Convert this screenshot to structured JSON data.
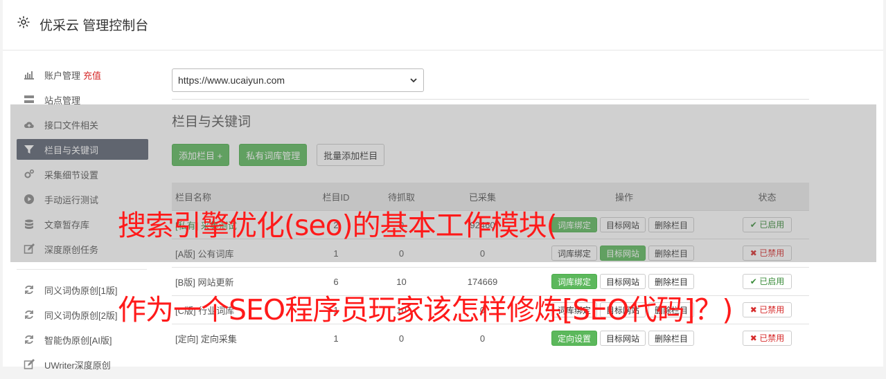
{
  "header": {
    "title": "优采云 管理控制台",
    "icon": "gear-icon"
  },
  "sidebar": {
    "items": [
      {
        "label": "账户管理",
        "extra": "充值",
        "icon": "bar-chart-icon"
      },
      {
        "label": "站点管理",
        "icon": "server-icon"
      },
      {
        "label": "接口文件相关",
        "icon": "cloud-upload-icon"
      },
      {
        "label": "栏目与关键词",
        "icon": "filter-icon",
        "active": true
      },
      {
        "label": "采集细节设置",
        "icon": "cogs-icon"
      },
      {
        "label": "手动运行测试",
        "icon": "play-circle-icon"
      },
      {
        "label": "文章暂存库",
        "icon": "database-icon"
      },
      {
        "label": "深度原创任务",
        "icon": "edit-icon"
      }
    ],
    "items2": [
      {
        "label": "同义词伪原创[1版]",
        "icon": "refresh-icon"
      },
      {
        "label": "同义词伪原创[2版]",
        "icon": "refresh-icon"
      },
      {
        "label": "智能伪原创[AI版]",
        "icon": "refresh-icon"
      },
      {
        "label": "UWriter深度原创",
        "icon": "edit-icon"
      }
    ]
  },
  "main": {
    "site_select": "https://www.ucaiyun.com",
    "section_title": "栏目与关键词",
    "buttons": {
      "add": "添加栏目 +",
      "private_lib": "私有词库管理",
      "batch_add": "批量添加栏目"
    },
    "table": {
      "headers": [
        "栏目名称",
        "栏目ID",
        "待抓取",
        "已采集",
        "操作",
        "状态"
      ],
      "rows": [
        {
          "name": "[私有] 采集测试",
          "id": "2",
          "pending": "0",
          "collected": "92460",
          "b1": "词库绑定",
          "b2": "目标网站",
          "b3": "删除栏目",
          "status": "已启用"
        },
        {
          "name": "[A版] 公有词库",
          "id": "1",
          "pending": "0",
          "collected": "0",
          "b1": "词库绑定",
          "b2": "目标网站",
          "b3": "删除栏目",
          "status": "已禁用"
        },
        {
          "name": "[B版] 网站更新",
          "id": "6",
          "pending": "10",
          "collected": "174669",
          "b1": "词库绑定",
          "b2": "目标网站",
          "b3": "删除栏目",
          "status": "已启用"
        },
        {
          "name": "[C版] 行业词库",
          "id": "1",
          "pending": "10",
          "collected": "0",
          "b1": "词库绑定",
          "b2": "目标网站",
          "b3": "删除栏目",
          "status": "已禁用"
        },
        {
          "name": "[定向] 定向采集",
          "id": "1",
          "pending": "0",
          "collected": "0",
          "b1": "定向设置",
          "b2": "目标网站",
          "b3": "删除栏目",
          "status": "已禁用"
        }
      ]
    }
  },
  "overlay_text": {
    "line1": "搜索引擎优化(seo)的基本工作模块(",
    "line2": "作为一个SEO程序员玩家该怎样修炼[SEO代码]？)"
  }
}
